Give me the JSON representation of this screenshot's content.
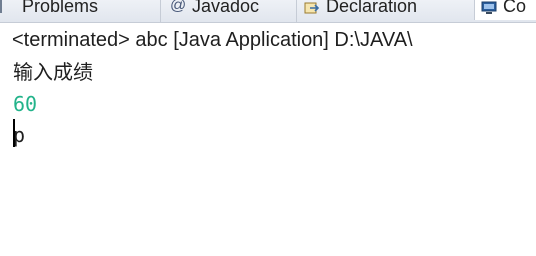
{
  "tabs": {
    "problems": {
      "label": "Problems",
      "icon": "problems-icon"
    },
    "javadoc": {
      "label": "Javadoc",
      "icon": "at-sign-icon"
    },
    "declaration": {
      "label": "Declaration",
      "icon": "declaration-icon"
    },
    "console": {
      "label": "Co",
      "icon": "console-icon"
    }
  },
  "console": {
    "header": "<terminated> abc [Java Application] D:\\JAVA\\",
    "lines": {
      "prompt": "输入成绩",
      "input_value": "60",
      "current_line": "p"
    },
    "colors": {
      "input_text": "#22b38a",
      "output_text": "#1f1f1f"
    }
  }
}
